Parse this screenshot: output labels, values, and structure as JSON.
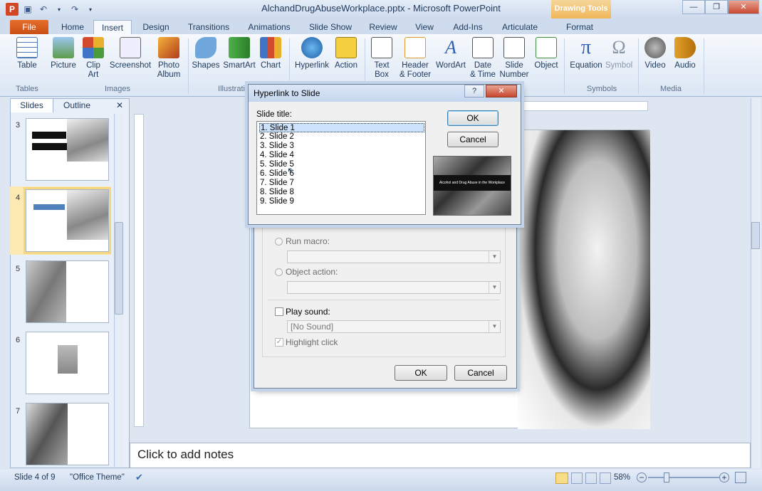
{
  "window": {
    "title": "AlchandDrugAbuseWorkplace.pptx - Microsoft PowerPoint",
    "context_tab_group": "Drawing Tools",
    "minimize": "—",
    "restore": "❐",
    "close": "✕"
  },
  "tabs": [
    "File",
    "Home",
    "Insert",
    "Design",
    "Transitions",
    "Animations",
    "Slide Show",
    "Review",
    "View",
    "Add-Ins",
    "Articulate",
    "Format"
  ],
  "ribbon": {
    "buttons": [
      {
        "label": "Table",
        "x": "Table"
      },
      {
        "label": "Picture"
      },
      {
        "label": "Clip\nArt"
      },
      {
        "label": "Screenshot"
      },
      {
        "label": "Photo\nAlbum"
      },
      {
        "label": "Shapes"
      },
      {
        "label": "SmartArt"
      },
      {
        "label": "Chart"
      },
      {
        "label": "Hyperlink"
      },
      {
        "label": "Action"
      },
      {
        "label": "Text\nBox"
      },
      {
        "label": "Header\n& Footer"
      },
      {
        "label": "WordArt"
      },
      {
        "label": "Date\n& Time"
      },
      {
        "label": "Slide\nNumber"
      },
      {
        "label": "Object"
      },
      {
        "label": "Equation"
      },
      {
        "label": "Symbol"
      },
      {
        "label": "Video"
      },
      {
        "label": "Audio"
      }
    ],
    "groups": [
      "Tables",
      "Images",
      "Illustrati",
      "Symbols",
      "Media"
    ]
  },
  "left_pane": {
    "tab_slides": "Slides",
    "tab_outline": "Outline",
    "close": "✕",
    "slide_numbers": [
      "3",
      "4",
      "5",
      "6",
      "7"
    ]
  },
  "notes_placeholder": "Click to add notes",
  "status": {
    "slide_info": "Slide 4 of 9",
    "theme": "\"Office Theme\"",
    "zoom": "58%"
  },
  "hyperlink_dialog": {
    "title": "Hyperlink to Slide",
    "list_label": "Slide title:",
    "slides": [
      "1. Slide 1",
      "2. Slide 2",
      "3. Slide 3",
      "4. Slide 4",
      "5. Slide 5",
      "6. Slide 6",
      "7. Slide 7",
      "8. Slide 8",
      "9. Slide 9"
    ],
    "selected_index": 0,
    "ok": "OK",
    "cancel": "Cancel",
    "help": "?",
    "close": "✕",
    "preview_text": "Alcohol and Drug Abuse in the Workplace"
  },
  "action_dialog": {
    "run_macro": "Run macro:",
    "object_action": "Object action:",
    "play_sound": "Play sound:",
    "sound_value": "[No Sound]",
    "highlight_click": "Highlight click",
    "ok": "OK",
    "cancel": "Cancel"
  }
}
